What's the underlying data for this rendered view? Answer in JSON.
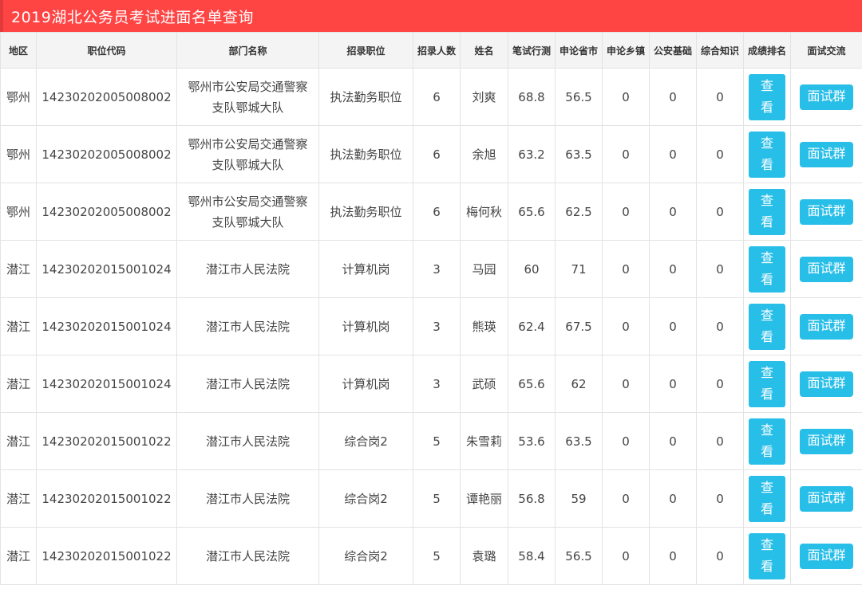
{
  "page": {
    "title": "2019湖北公务员考试进面名单查询"
  },
  "colors": {
    "title_bg": "#ff4444",
    "button": "#27bee8",
    "header_bg": "#f4f4f4"
  },
  "table": {
    "headers": {
      "region": "地区",
      "code": "职位代码",
      "dept": "部门名称",
      "position": "招录职位",
      "count": "招录人数",
      "name": "姓名",
      "written": "笔试行测",
      "essay": "申论省市",
      "essay_town": "申论乡镇",
      "police": "公安基础",
      "general": "综合知识",
      "rank": "成绩排名",
      "group": "面试交流"
    },
    "view_label_1": "查",
    "view_label_2": "看",
    "group_label": "面试群",
    "rows": [
      {
        "region": "鄂州",
        "code": "14230202005008002",
        "dept_1": "鄂州市公安局交通警察",
        "dept_2": "支队鄂城大队",
        "position": "执法勤务职位",
        "count": "6",
        "name": "刘爽",
        "written": "68.8",
        "essay": "56.5",
        "essay_town": "0",
        "police": "0",
        "general": "0"
      },
      {
        "region": "鄂州",
        "code": "14230202005008002",
        "dept_1": "鄂州市公安局交通警察",
        "dept_2": "支队鄂城大队",
        "position": "执法勤务职位",
        "count": "6",
        "name": "余旭",
        "written": "63.2",
        "essay": "63.5",
        "essay_town": "0",
        "police": "0",
        "general": "0"
      },
      {
        "region": "鄂州",
        "code": "14230202005008002",
        "dept_1": "鄂州市公安局交通警察",
        "dept_2": "支队鄂城大队",
        "position": "执法勤务职位",
        "count": "6",
        "name": "梅何秋",
        "written": "65.6",
        "essay": "62.5",
        "essay_town": "0",
        "police": "0",
        "general": "0"
      },
      {
        "region": "潜江",
        "code": "14230202015001024",
        "dept_1": "潜江市人民法院",
        "dept_2": "",
        "position": "计算机岗",
        "count": "3",
        "name": "马园",
        "written": "60",
        "essay": "71",
        "essay_town": "0",
        "police": "0",
        "general": "0"
      },
      {
        "region": "潜江",
        "code": "14230202015001024",
        "dept_1": "潜江市人民法院",
        "dept_2": "",
        "position": "计算机岗",
        "count": "3",
        "name": "熊瑛",
        "written": "62.4",
        "essay": "67.5",
        "essay_town": "0",
        "police": "0",
        "general": "0"
      },
      {
        "region": "潜江",
        "code": "14230202015001024",
        "dept_1": "潜江市人民法院",
        "dept_2": "",
        "position": "计算机岗",
        "count": "3",
        "name": "武硕",
        "written": "65.6",
        "essay": "62",
        "essay_town": "0",
        "police": "0",
        "general": "0"
      },
      {
        "region": "潜江",
        "code": "14230202015001022",
        "dept_1": "潜江市人民法院",
        "dept_2": "",
        "position": "综合岗2",
        "count": "5",
        "name": "朱雪莉",
        "written": "53.6",
        "essay": "63.5",
        "essay_town": "0",
        "police": "0",
        "general": "0"
      },
      {
        "region": "潜江",
        "code": "14230202015001022",
        "dept_1": "潜江市人民法院",
        "dept_2": "",
        "position": "综合岗2",
        "count": "5",
        "name": "谭艳丽",
        "written": "56.8",
        "essay": "59",
        "essay_town": "0",
        "police": "0",
        "general": "0"
      },
      {
        "region": "潜江",
        "code": "14230202015001022",
        "dept_1": "潜江市人民法院",
        "dept_2": "",
        "position": "综合岗2",
        "count": "5",
        "name": "袁璐",
        "written": "58.4",
        "essay": "56.5",
        "essay_town": "0",
        "police": "0",
        "general": "0"
      }
    ]
  }
}
